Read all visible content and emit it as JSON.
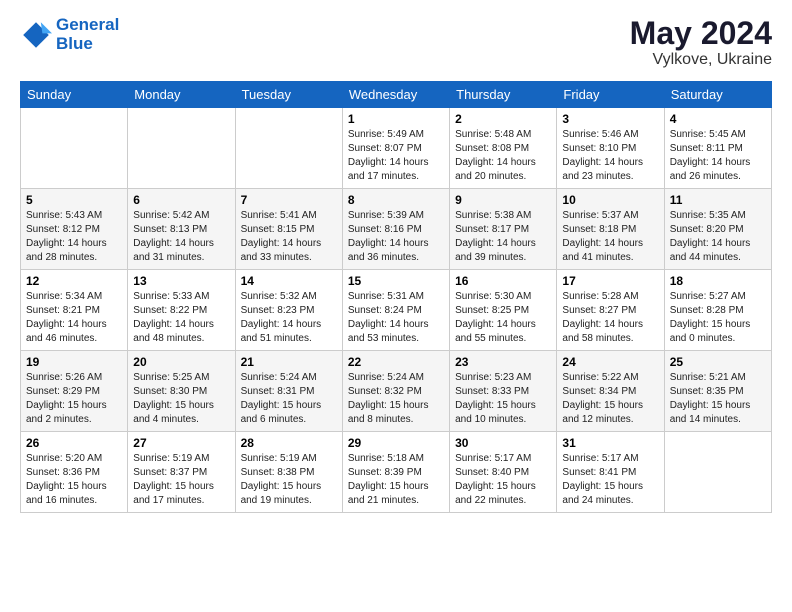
{
  "logo": {
    "line1": "General",
    "line2": "Blue"
  },
  "title": {
    "month_year": "May 2024",
    "location": "Vylkove, Ukraine"
  },
  "days_of_week": [
    "Sunday",
    "Monday",
    "Tuesday",
    "Wednesday",
    "Thursday",
    "Friday",
    "Saturday"
  ],
  "weeks": [
    [
      {
        "day": "",
        "info": ""
      },
      {
        "day": "",
        "info": ""
      },
      {
        "day": "",
        "info": ""
      },
      {
        "day": "1",
        "info": "Sunrise: 5:49 AM\nSunset: 8:07 PM\nDaylight: 14 hours\nand 17 minutes."
      },
      {
        "day": "2",
        "info": "Sunrise: 5:48 AM\nSunset: 8:08 PM\nDaylight: 14 hours\nand 20 minutes."
      },
      {
        "day": "3",
        "info": "Sunrise: 5:46 AM\nSunset: 8:10 PM\nDaylight: 14 hours\nand 23 minutes."
      },
      {
        "day": "4",
        "info": "Sunrise: 5:45 AM\nSunset: 8:11 PM\nDaylight: 14 hours\nand 26 minutes."
      }
    ],
    [
      {
        "day": "5",
        "info": "Sunrise: 5:43 AM\nSunset: 8:12 PM\nDaylight: 14 hours\nand 28 minutes."
      },
      {
        "day": "6",
        "info": "Sunrise: 5:42 AM\nSunset: 8:13 PM\nDaylight: 14 hours\nand 31 minutes."
      },
      {
        "day": "7",
        "info": "Sunrise: 5:41 AM\nSunset: 8:15 PM\nDaylight: 14 hours\nand 33 minutes."
      },
      {
        "day": "8",
        "info": "Sunrise: 5:39 AM\nSunset: 8:16 PM\nDaylight: 14 hours\nand 36 minutes."
      },
      {
        "day": "9",
        "info": "Sunrise: 5:38 AM\nSunset: 8:17 PM\nDaylight: 14 hours\nand 39 minutes."
      },
      {
        "day": "10",
        "info": "Sunrise: 5:37 AM\nSunset: 8:18 PM\nDaylight: 14 hours\nand 41 minutes."
      },
      {
        "day": "11",
        "info": "Sunrise: 5:35 AM\nSunset: 8:20 PM\nDaylight: 14 hours\nand 44 minutes."
      }
    ],
    [
      {
        "day": "12",
        "info": "Sunrise: 5:34 AM\nSunset: 8:21 PM\nDaylight: 14 hours\nand 46 minutes."
      },
      {
        "day": "13",
        "info": "Sunrise: 5:33 AM\nSunset: 8:22 PM\nDaylight: 14 hours\nand 48 minutes."
      },
      {
        "day": "14",
        "info": "Sunrise: 5:32 AM\nSunset: 8:23 PM\nDaylight: 14 hours\nand 51 minutes."
      },
      {
        "day": "15",
        "info": "Sunrise: 5:31 AM\nSunset: 8:24 PM\nDaylight: 14 hours\nand 53 minutes."
      },
      {
        "day": "16",
        "info": "Sunrise: 5:30 AM\nSunset: 8:25 PM\nDaylight: 14 hours\nand 55 minutes."
      },
      {
        "day": "17",
        "info": "Sunrise: 5:28 AM\nSunset: 8:27 PM\nDaylight: 14 hours\nand 58 minutes."
      },
      {
        "day": "18",
        "info": "Sunrise: 5:27 AM\nSunset: 8:28 PM\nDaylight: 15 hours\nand 0 minutes."
      }
    ],
    [
      {
        "day": "19",
        "info": "Sunrise: 5:26 AM\nSunset: 8:29 PM\nDaylight: 15 hours\nand 2 minutes."
      },
      {
        "day": "20",
        "info": "Sunrise: 5:25 AM\nSunset: 8:30 PM\nDaylight: 15 hours\nand 4 minutes."
      },
      {
        "day": "21",
        "info": "Sunrise: 5:24 AM\nSunset: 8:31 PM\nDaylight: 15 hours\nand 6 minutes."
      },
      {
        "day": "22",
        "info": "Sunrise: 5:24 AM\nSunset: 8:32 PM\nDaylight: 15 hours\nand 8 minutes."
      },
      {
        "day": "23",
        "info": "Sunrise: 5:23 AM\nSunset: 8:33 PM\nDaylight: 15 hours\nand 10 minutes."
      },
      {
        "day": "24",
        "info": "Sunrise: 5:22 AM\nSunset: 8:34 PM\nDaylight: 15 hours\nand 12 minutes."
      },
      {
        "day": "25",
        "info": "Sunrise: 5:21 AM\nSunset: 8:35 PM\nDaylight: 15 hours\nand 14 minutes."
      }
    ],
    [
      {
        "day": "26",
        "info": "Sunrise: 5:20 AM\nSunset: 8:36 PM\nDaylight: 15 hours\nand 16 minutes."
      },
      {
        "day": "27",
        "info": "Sunrise: 5:19 AM\nSunset: 8:37 PM\nDaylight: 15 hours\nand 17 minutes."
      },
      {
        "day": "28",
        "info": "Sunrise: 5:19 AM\nSunset: 8:38 PM\nDaylight: 15 hours\nand 19 minutes."
      },
      {
        "day": "29",
        "info": "Sunrise: 5:18 AM\nSunset: 8:39 PM\nDaylight: 15 hours\nand 21 minutes."
      },
      {
        "day": "30",
        "info": "Sunrise: 5:17 AM\nSunset: 8:40 PM\nDaylight: 15 hours\nand 22 minutes."
      },
      {
        "day": "31",
        "info": "Sunrise: 5:17 AM\nSunset: 8:41 PM\nDaylight: 15 hours\nand 24 minutes."
      },
      {
        "day": "",
        "info": ""
      }
    ]
  ]
}
